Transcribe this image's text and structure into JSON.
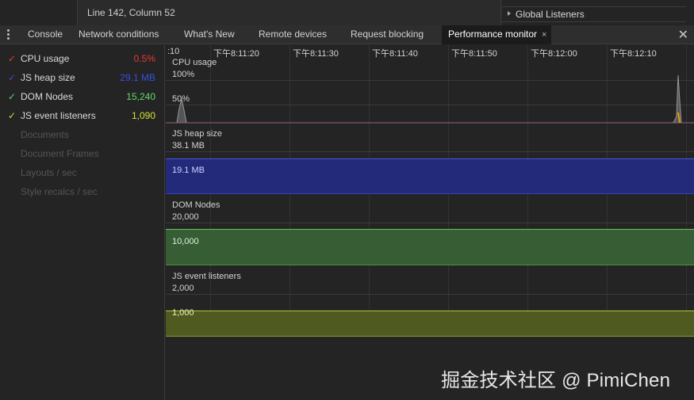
{
  "editor": {
    "status": "Line 142, Column 52"
  },
  "sidepane": {
    "global_listeners": "Global Listeners"
  },
  "tabs": {
    "items": [
      {
        "label": "Console"
      },
      {
        "label": "Network conditions"
      },
      {
        "label": "What's New"
      },
      {
        "label": "Remote devices"
      },
      {
        "label": "Request blocking"
      },
      {
        "label": "Performance monitor",
        "active": true
      }
    ],
    "close_tab_glyph": "×",
    "close_drawer_glyph": "✕"
  },
  "metrics": [
    {
      "label": "CPU usage",
      "value": "0.5%",
      "checked": true,
      "color": "#e53935"
    },
    {
      "label": "JS heap size",
      "value": "29.1 MB",
      "checked": true,
      "color": "#3b4bd1"
    },
    {
      "label": "DOM Nodes",
      "value": "15,240",
      "checked": true,
      "color": "#5fcf65"
    },
    {
      "label": "JS event listeners",
      "value": "1,090",
      "checked": true,
      "color": "#c8d93a"
    },
    {
      "label": "Documents",
      "checked": false
    },
    {
      "label": "Document Frames",
      "checked": false
    },
    {
      "label": "Layouts / sec",
      "checked": false
    },
    {
      "label": "Style recalcs / sec",
      "checked": false
    }
  ],
  "timeline": {
    "ticks": [
      ":10",
      "下午8:11:20",
      "下午8:11:30",
      "下午8:11:40",
      "下午8:11:50",
      "下午8:12:00",
      "下午8:12:10"
    ]
  },
  "charts": {
    "cpu": {
      "title": "CPU usage",
      "label_top": "100%",
      "label_mid": "50%"
    },
    "heap": {
      "title": "JS heap size",
      "label_top": "38.1 MB",
      "label_mid": "19.1 MB"
    },
    "dom": {
      "title": "DOM Nodes",
      "label_top": "20,000",
      "label_mid": "10,000"
    },
    "listeners": {
      "title": "JS event listeners",
      "label_top": "2,000",
      "label_mid": "1,000"
    }
  },
  "watermark": "掘金技术社区 @ PimiChen"
}
